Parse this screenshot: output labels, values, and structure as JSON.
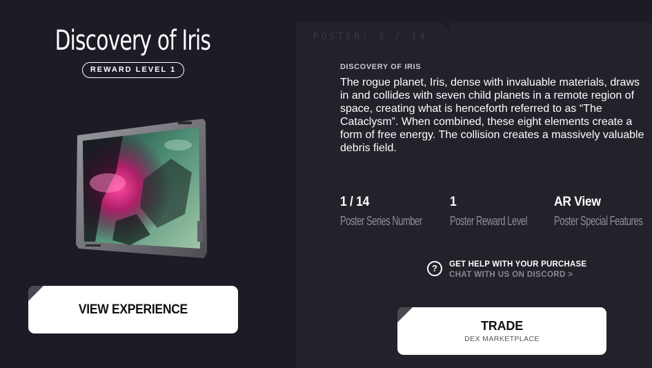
{
  "left": {
    "title": "Discovery of Iris",
    "reward_badge": "REWARD LEVEL 1",
    "view_button": "VIEW EXPERIENCE"
  },
  "right": {
    "poster_count": "POSTER: 1 / 14",
    "description_heading": "DISCOVERY OF IRIS",
    "description": "The rogue planet, Iris, dense with invaluable materials, draws in and collides with seven child planets in a remote region of space, creating what is henceforth referred to as “The Cataclysm”. When combined, these eight elements create a form of free energy. The collision creates a massively valuable debris field.",
    "stats": [
      {
        "value": "1 / 14",
        "label": "Poster Series Number"
      },
      {
        "value": "1",
        "label": "Poster Reward Level"
      },
      {
        "value": "AR View",
        "label": "Poster Special Features"
      }
    ],
    "help": {
      "icon": "question-circle-icon",
      "title": "GET HELP WITH YOUR PURCHASE",
      "link": "CHAT WITH US ON DISCORD >"
    },
    "trade_button": {
      "label": "TRADE",
      "sublabel": "DEX MARKETPLACE"
    }
  },
  "colors": {
    "background": "#1d1c26",
    "panel": "#232129",
    "button": "#ffffff",
    "muted_text": "#8f8d96"
  }
}
